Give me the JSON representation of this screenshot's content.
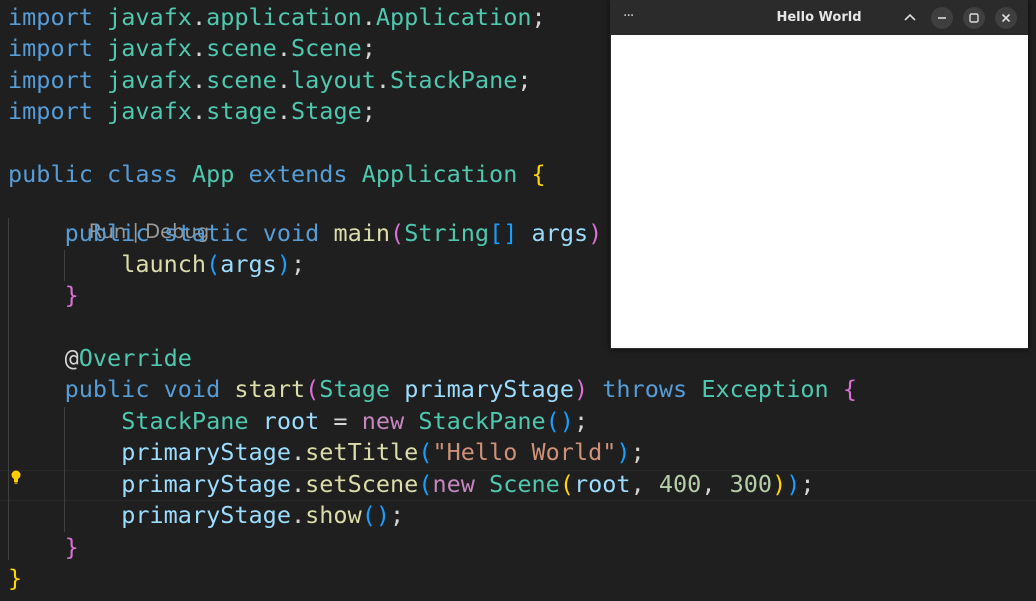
{
  "window": {
    "title": "Hello World",
    "menu_icon": "ellipsis-icon",
    "controls": [
      "chevron-up-icon",
      "minimize-icon",
      "maximize-icon",
      "close-icon"
    ]
  },
  "editor": {
    "codelens": {
      "run": "Run",
      "separator": " | ",
      "debug": "Debug"
    },
    "lines": [
      [
        {
          "c": "imp",
          "t": "import "
        },
        {
          "c": "pkg",
          "t": "javafx"
        },
        {
          "c": "pl",
          "t": "."
        },
        {
          "c": "pkg",
          "t": "application"
        },
        {
          "c": "pl",
          "t": "."
        },
        {
          "c": "typ",
          "t": "Application"
        },
        {
          "c": "pl",
          "t": ";"
        }
      ],
      [
        {
          "c": "imp",
          "t": "import "
        },
        {
          "c": "pkg",
          "t": "javafx"
        },
        {
          "c": "pl",
          "t": "."
        },
        {
          "c": "pkg",
          "t": "scene"
        },
        {
          "c": "pl",
          "t": "."
        },
        {
          "c": "typ",
          "t": "Scene"
        },
        {
          "c": "pl",
          "t": ";"
        }
      ],
      [
        {
          "c": "imp",
          "t": "import "
        },
        {
          "c": "pkg",
          "t": "javafx"
        },
        {
          "c": "pl",
          "t": "."
        },
        {
          "c": "pkg",
          "t": "scene"
        },
        {
          "c": "pl",
          "t": "."
        },
        {
          "c": "pkg",
          "t": "layout"
        },
        {
          "c": "pl",
          "t": "."
        },
        {
          "c": "typ",
          "t": "StackPane"
        },
        {
          "c": "pl",
          "t": ";"
        }
      ],
      [
        {
          "c": "imp",
          "t": "import "
        },
        {
          "c": "pkg",
          "t": "javafx"
        },
        {
          "c": "pl",
          "t": "."
        },
        {
          "c": "pkg",
          "t": "stage"
        },
        {
          "c": "pl",
          "t": "."
        },
        {
          "c": "typ",
          "t": "Stage"
        },
        {
          "c": "pl",
          "t": ";"
        }
      ],
      [],
      [
        {
          "c": "kw",
          "t": "public "
        },
        {
          "c": "kw",
          "t": "class "
        },
        {
          "c": "typ",
          "t": "App "
        },
        {
          "c": "kw",
          "t": "extends "
        },
        {
          "c": "typ",
          "t": "Application "
        },
        {
          "c": "b1",
          "t": "{"
        }
      ],
      [
        {
          "c": "pl",
          "t": "    "
        },
        {
          "c": "kw",
          "t": "public "
        },
        {
          "c": "kw",
          "t": "static "
        },
        {
          "c": "kw",
          "t": "void "
        },
        {
          "c": "fn",
          "t": "main"
        },
        {
          "c": "b2",
          "t": "("
        },
        {
          "c": "typ",
          "t": "String"
        },
        {
          "c": "b3",
          "t": "[]"
        },
        {
          "c": "pl",
          "t": " "
        },
        {
          "c": "var",
          "t": "args"
        },
        {
          "c": "b2",
          "t": ")"
        }
      ],
      [
        {
          "c": "pl",
          "t": "        "
        },
        {
          "c": "fn",
          "t": "launch"
        },
        {
          "c": "b3",
          "t": "("
        },
        {
          "c": "var",
          "t": "args"
        },
        {
          "c": "b3",
          "t": ")"
        },
        {
          "c": "pl",
          "t": ";"
        }
      ],
      [
        {
          "c": "pl",
          "t": "    "
        },
        {
          "c": "b2",
          "t": "}"
        }
      ],
      [],
      [
        {
          "c": "pl",
          "t": "    "
        },
        {
          "c": "pl",
          "t": "@"
        },
        {
          "c": "ann",
          "t": "Override"
        }
      ],
      [
        {
          "c": "pl",
          "t": "    "
        },
        {
          "c": "kw",
          "t": "public "
        },
        {
          "c": "kw",
          "t": "void "
        },
        {
          "c": "fn",
          "t": "start"
        },
        {
          "c": "b2",
          "t": "("
        },
        {
          "c": "typ",
          "t": "Stage "
        },
        {
          "c": "var",
          "t": "primaryStage"
        },
        {
          "c": "b2",
          "t": ")"
        },
        {
          "c": "pl",
          "t": " "
        },
        {
          "c": "kw",
          "t": "throws "
        },
        {
          "c": "typ",
          "t": "Exception "
        },
        {
          "c": "b2",
          "t": "{"
        }
      ],
      [
        {
          "c": "pl",
          "t": "        "
        },
        {
          "c": "typ",
          "t": "StackPane "
        },
        {
          "c": "var",
          "t": "root"
        },
        {
          "c": "pl",
          "t": " = "
        },
        {
          "c": "newk",
          "t": "new "
        },
        {
          "c": "typ",
          "t": "StackPane"
        },
        {
          "c": "b3",
          "t": "()"
        },
        {
          "c": "pl",
          "t": ";"
        }
      ],
      [
        {
          "c": "pl",
          "t": "        "
        },
        {
          "c": "var",
          "t": "primaryStage"
        },
        {
          "c": "pl",
          "t": "."
        },
        {
          "c": "fn",
          "t": "setTitle"
        },
        {
          "c": "b3",
          "t": "("
        },
        {
          "c": "str",
          "t": "\"Hello World\""
        },
        {
          "c": "b3",
          "t": ")"
        },
        {
          "c": "pl",
          "t": ";"
        }
      ],
      [
        {
          "c": "pl",
          "t": "        "
        },
        {
          "c": "var",
          "t": "primaryStage"
        },
        {
          "c": "pl",
          "t": "."
        },
        {
          "c": "fn",
          "t": "setScene"
        },
        {
          "c": "b3",
          "t": "("
        },
        {
          "c": "newk",
          "t": "new "
        },
        {
          "c": "typ",
          "t": "Scene"
        },
        {
          "c": "b1",
          "t": "("
        },
        {
          "c": "var",
          "t": "root"
        },
        {
          "c": "pl",
          "t": ", "
        },
        {
          "c": "num",
          "t": "400"
        },
        {
          "c": "pl",
          "t": ", "
        },
        {
          "c": "num",
          "t": "300"
        },
        {
          "c": "b1",
          "t": ")"
        },
        {
          "c": "b3",
          "t": ")"
        },
        {
          "c": "pl",
          "t": ";"
        }
      ],
      [
        {
          "c": "pl",
          "t": "        "
        },
        {
          "c": "var",
          "t": "primaryStage"
        },
        {
          "c": "pl",
          "t": "."
        },
        {
          "c": "fn",
          "t": "show"
        },
        {
          "c": "b3",
          "t": "()"
        },
        {
          "c": "pl",
          "t": ";"
        }
      ],
      [
        {
          "c": "pl",
          "t": "    "
        },
        {
          "c": "b2",
          "t": "}"
        }
      ],
      [
        {
          "c": "b1",
          "t": "}"
        }
      ]
    ]
  },
  "colors": {
    "editor_bg": "#1f1f1f",
    "window_client_bg": "#ffffff",
    "lightbulb": "#ffcc00"
  }
}
